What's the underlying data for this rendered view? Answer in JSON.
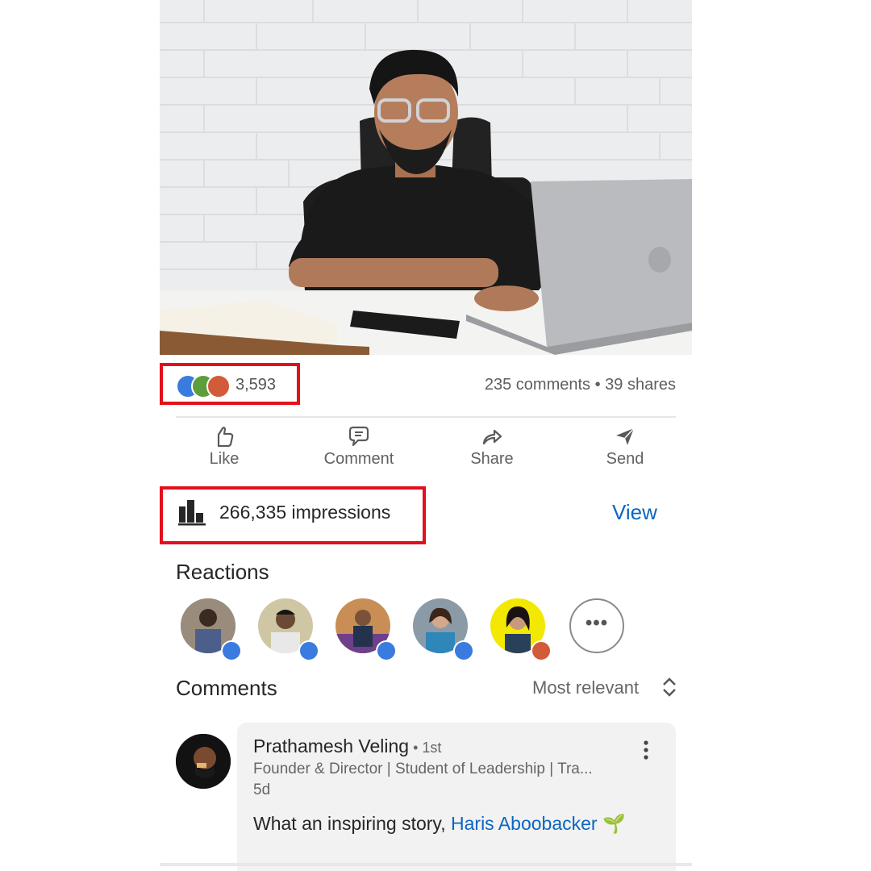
{
  "post": {
    "reactions": {
      "icons": [
        "like-icon",
        "celebrate-icon",
        "love-icon"
      ],
      "count": "3,593"
    },
    "stats": {
      "comments": "235 comments",
      "separator": " • ",
      "shares": "39 shares"
    },
    "actions": [
      {
        "label": "Like",
        "icon": "like-icon"
      },
      {
        "label": "Comment",
        "icon": "comment-icon"
      },
      {
        "label": "Share",
        "icon": "share-icon"
      },
      {
        "label": "Send",
        "icon": "send-icon"
      }
    ],
    "impressions": {
      "text": "266,335 impressions",
      "view_label": "View"
    }
  },
  "reactions_section": {
    "title": "Reactions",
    "reactors": [
      {
        "badge": "like-icon"
      },
      {
        "badge": "like-icon"
      },
      {
        "badge": "like-icon"
      },
      {
        "badge": "like-icon"
      },
      {
        "badge": "love-icon"
      }
    ],
    "more_label": "•••"
  },
  "comments_section": {
    "title": "Comments",
    "sort_label": "Most relevant",
    "comments": [
      {
        "author": "Prathamesh Veling",
        "degree": " • 1st",
        "headline": "Founder & Director | Student of Leadership | Tra...",
        "time": "5d",
        "text_prefix": "What an inspiring story, ",
        "mention": "Haris Aboobacker",
        "emoji": "🌱"
      }
    ]
  },
  "colors": {
    "highlight_box": "#e3101b",
    "link": "#0a66c2",
    "like": "#3a7be0",
    "celebrate": "#5c9e3b",
    "love": "#d25b3a"
  }
}
